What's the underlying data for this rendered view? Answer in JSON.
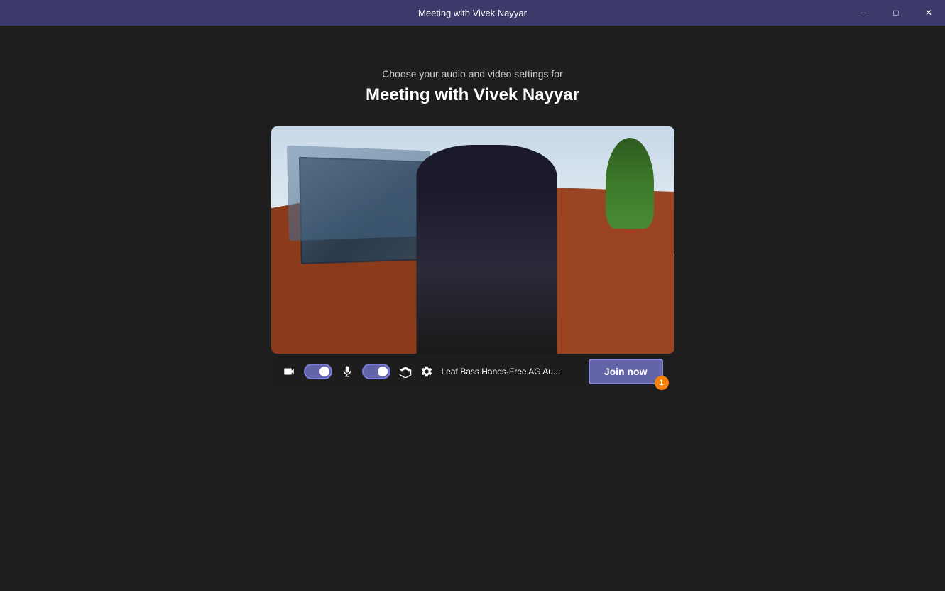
{
  "titlebar": {
    "title": "Meeting with Vivek Nayyar",
    "minimize_label": "─",
    "maximize_label": "□",
    "close_label": "✕"
  },
  "header": {
    "subtitle": "Choose your audio and video settings for",
    "meeting_title": "Meeting with Vivek Nayyar"
  },
  "controls": {
    "audio_device_label": "Leaf Bass Hands-Free AG Au...",
    "join_button_label": "Join now",
    "notification_count": "1"
  }
}
